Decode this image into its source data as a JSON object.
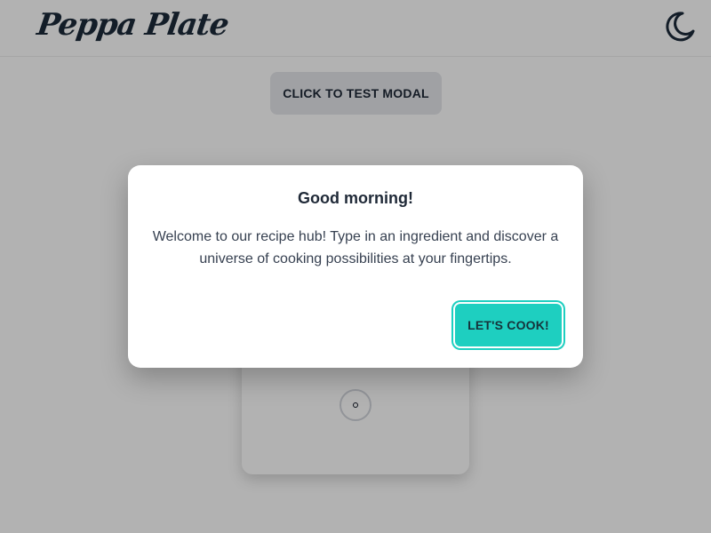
{
  "navbar": {
    "logo_text": "Peppa Plate",
    "theme_toggle_icon": "moon-icon"
  },
  "main": {
    "test_modal_button_label": "CLICK TO TEST MODAL",
    "loading_icon": "spinner-icon"
  },
  "modal": {
    "title": "Good morning!",
    "body": "Welcome to our recipe hub! Type in an ingredient and discover a universe of cooking possibilities at your fingertips.",
    "confirm_button_label": "LET'S COOK!"
  },
  "colors": {
    "accent": "#1ecfc0",
    "text_dark": "#1f2937",
    "overlay": "rgba(0,0,0,0.30)"
  }
}
